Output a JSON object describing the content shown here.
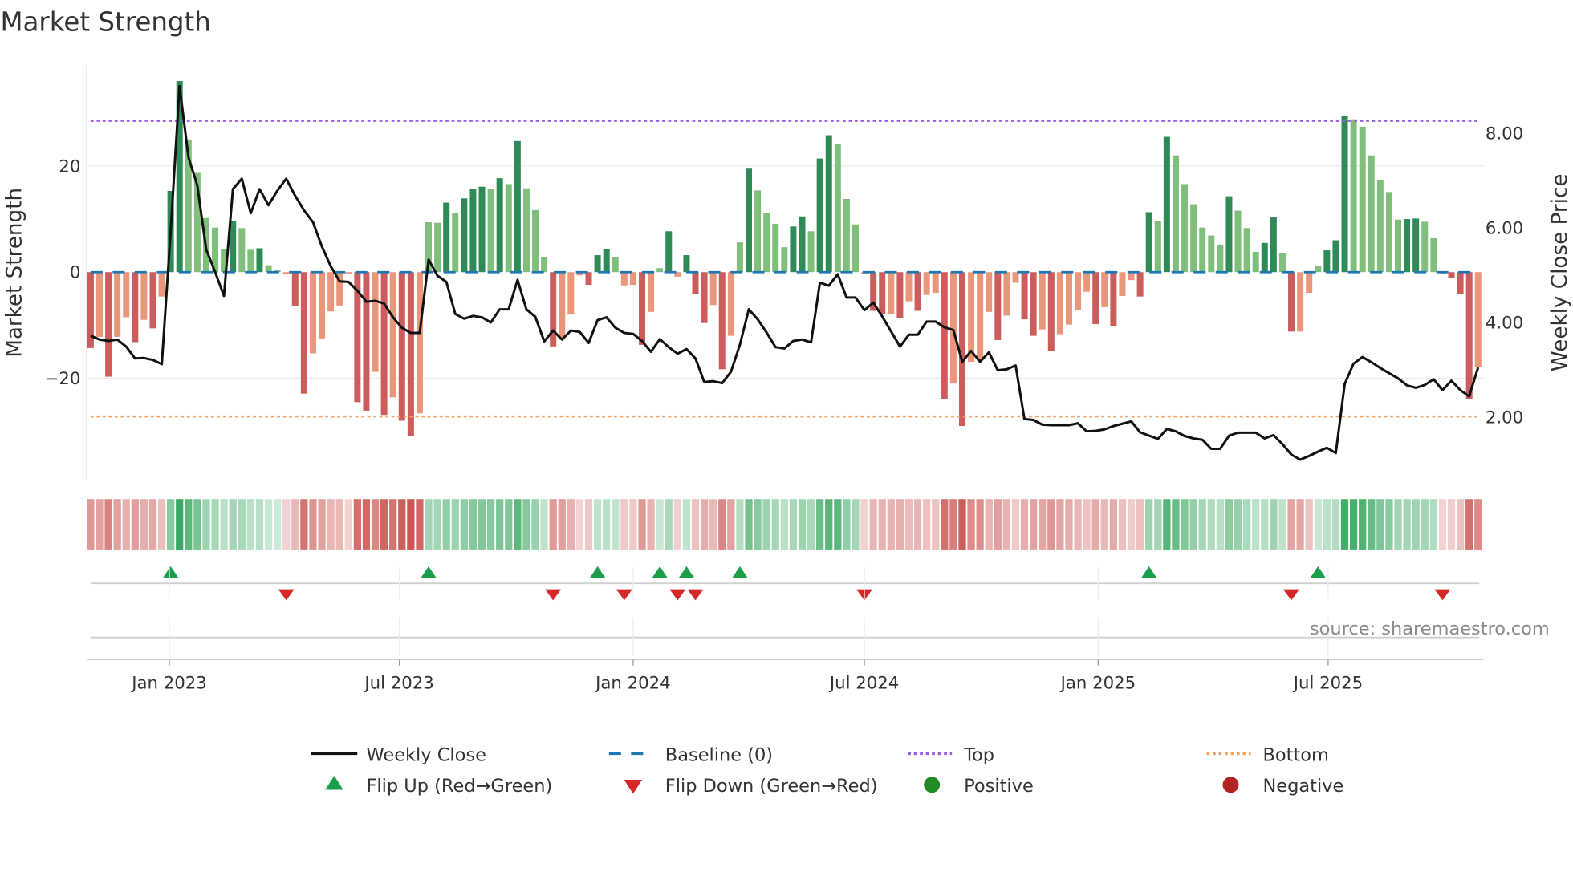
{
  "title": "Market Strength",
  "source": "source: sharemaestro.com",
  "colors": {
    "pos_strong": "#2e8b57",
    "pos_weak": "#7fbf7b",
    "neg_strong": "#cd5c5c",
    "neg_weak": "#e9967a",
    "heat_pos": "#3aa860",
    "heat_neg": "#c9504c",
    "close": "#111111",
    "baseline": "#1f77b4",
    "top": "#9b5de5",
    "bottom": "#f4a261",
    "flip_up": "#1a9e4a",
    "flip_down": "#d62728",
    "positive": "#228b22",
    "negative": "#b22222"
  },
  "legend": {
    "close": "Weekly Close",
    "baseline": "Baseline (0)",
    "top": "Top",
    "bottom": "Bottom",
    "flip_up": "Flip Up (Red→Green)",
    "flip_down": "Flip Down (Green→Red)",
    "positive": "Positive",
    "negative": "Negative"
  },
  "chart_data": {
    "type": "bar",
    "title": "Market Strength",
    "ylabel": "Market Strength",
    "y2label": "Weekly Close Price",
    "ylim": [
      -39,
      39
    ],
    "y2lim": [
      0.67,
      9.42
    ],
    "yticks": [
      -20,
      0,
      20
    ],
    "ytick_labels": [
      "−20",
      "0",
      "20"
    ],
    "y2ticks": [
      2,
      4,
      6,
      8
    ],
    "y2tick_labels": [
      "2.00",
      "4.00",
      "6.00",
      "8.00"
    ],
    "xticks": [
      "2023-01-01",
      "2023-07-01",
      "2024-01-01",
      "2024-07-01",
      "2025-01-01",
      "2025-07-01"
    ],
    "xtick_labels": [
      "Jan 2023",
      "Jul 2023",
      "Jan 2024",
      "Jul 2024",
      "Jan 2025",
      "Jul 2025"
    ],
    "start_date": "2022-10-31",
    "interval_days": 7,
    "top": 28.5,
    "bottom": -27.2,
    "baseline": 0,
    "strength": [
      -14.3,
      -12.2,
      -19.7,
      -12.2,
      -8.5,
      -13.2,
      -9.0,
      -10.6,
      -4.6,
      15.3,
      36.0,
      25.0,
      18.7,
      10.2,
      8.4,
      4.3,
      9.7,
      8.3,
      4.2,
      4.5,
      1.3,
      0.4,
      -0.3,
      -6.4,
      -22.9,
      -15.3,
      -12.5,
      -7.4,
      -6.3,
      -0.3,
      -24.5,
      -26.1,
      -18.8,
      -26.9,
      -23.6,
      -28.0,
      -30.8,
      -26.6,
      9.4,
      9.3,
      13.1,
      11.1,
      13.9,
      15.6,
      16.1,
      15.7,
      17.7,
      16.6,
      24.7,
      15.8,
      11.7,
      2.9,
      -14.0,
      -12.7,
      -8.0,
      -0.6,
      -2.4,
      3.2,
      4.4,
      2.8,
      -2.5,
      -2.4,
      -13.7,
      -7.5,
      0.75,
      7.7,
      -0.85,
      3.2,
      -4.2,
      -9.6,
      -6.2,
      -18.3,
      -12.0,
      5.6,
      19.5,
      15.4,
      11.1,
      9.1,
      4.7,
      8.6,
      10.5,
      7.7,
      21.4,
      25.8,
      24.2,
      13.8,
      9.0,
      -0.35,
      -7.3,
      -8.0,
      -7.9,
      -8.6,
      -5.5,
      -7.3,
      -4.3,
      -3.9,
      -23.9,
      -21.0,
      -29.0,
      -16.9,
      -16.7,
      -7.5,
      -12.8,
      -8.2,
      -2.0,
      -8.9,
      -12.0,
      -10.8,
      -14.8,
      -11.7,
      -9.9,
      -7.1,
      -3.7,
      -9.8,
      -6.6,
      -10.2,
      -4.5,
      -1.5,
      -4.6,
      11.3,
      9.7,
      25.5,
      22.0,
      16.6,
      12.8,
      8.4,
      6.9,
      5.2,
      14.3,
      11.6,
      8.3,
      3.8,
      5.5,
      10.3,
      3.6,
      -11.2,
      -11.2,
      -3.9,
      1.1,
      4.1,
      6.0,
      29.5,
      28.8,
      27.4,
      22.0,
      17.4,
      15.1,
      9.9,
      10.0,
      10.1,
      9.5,
      6.4,
      -0.3,
      -1.1,
      -4.2,
      -23.9,
      -17.9
    ],
    "close": [
      3.7,
      3.62,
      3.59,
      3.62,
      3.47,
      3.22,
      3.23,
      3.19,
      3.1,
      5.9,
      8.98,
      7.47,
      6.88,
      5.52,
      5.05,
      4.54,
      6.8,
      7.02,
      6.29,
      6.8,
      6.46,
      6.77,
      7.02,
      6.66,
      6.35,
      6.1,
      5.59,
      5.17,
      4.85,
      4.84,
      4.65,
      4.42,
      4.44,
      4.38,
      4.09,
      3.87,
      3.76,
      3.76,
      5.31,
      4.97,
      4.84,
      4.16,
      4.06,
      4.12,
      4.09,
      3.98,
      4.26,
      4.26,
      4.88,
      4.26,
      4.1,
      3.58,
      3.81,
      3.62,
      3.81,
      3.78,
      3.55,
      4.03,
      4.09,
      3.87,
      3.76,
      3.74,
      3.59,
      3.36,
      3.63,
      3.46,
      3.32,
      3.42,
      3.22,
      2.72,
      2.74,
      2.7,
      2.94,
      3.51,
      4.26,
      4.05,
      3.77,
      3.46,
      3.43,
      3.59,
      3.62,
      3.56,
      4.82,
      4.76,
      5.0,
      4.51,
      4.51,
      4.24,
      4.4,
      4.11,
      3.79,
      3.47,
      3.72,
      3.72,
      4.0,
      4.0,
      3.88,
      3.82,
      3.15,
      3.38,
      3.15,
      3.35,
      2.97,
      2.99,
      3.07,
      1.94,
      1.92,
      1.82,
      1.81,
      1.81,
      1.81,
      1.85,
      1.68,
      1.69,
      1.72,
      1.79,
      1.84,
      1.89,
      1.66,
      1.59,
      1.52,
      1.73,
      1.68,
      1.58,
      1.53,
      1.5,
      1.31,
      1.31,
      1.59,
      1.65,
      1.65,
      1.65,
      1.53,
      1.6,
      1.41,
      1.19,
      1.08,
      1.16,
      1.25,
      1.33,
      1.22,
      2.68,
      3.11,
      3.25,
      3.14,
      3.02,
      2.91,
      2.8,
      2.65,
      2.6,
      2.66,
      2.78,
      2.55,
      2.75,
      2.55,
      2.42,
      3.03
    ]
  }
}
